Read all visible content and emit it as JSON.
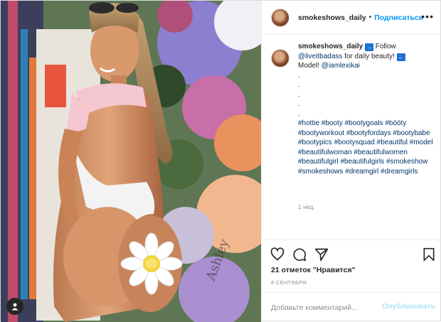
{
  "header": {
    "username": "smokeshows_daily",
    "separator": "•",
    "follow_label": "Подписаться",
    "more_icon": "more-horizontal-icon"
  },
  "caption": {
    "username": "smokeshows_daily",
    "follow_word": "Follow",
    "mention_1": "@liveitbadass",
    "text_1": "for daily beauty!",
    "text_2": "Model!",
    "mention_2": "@iamlexikai",
    "spacer": ".",
    "hashtags": "#hottie #booty #bootygoals #bööty #bootyworkout #bootyfordays #bootybabe #bootypics #bootysquad #beautiful #model #beautifulwoman #beautifulwomen #beautifulgirl #beautifulgirls #smokeshow #smokeshows #dreamgirl #dreamgirls",
    "time_ago": "1 нед."
  },
  "actions": {
    "like_icon": "heart-icon",
    "comment_icon": "comment-icon",
    "share_icon": "share-icon",
    "save_icon": "bookmark-icon"
  },
  "likes_text": "21 отметок \"Нравится\"",
  "date_text": "8 СЕНТЯБРЯ",
  "comment": {
    "placeholder": "Добавьте комментарий...",
    "publish_label": "Опубликовать"
  },
  "colors": {
    "link_blue": "#0095f6",
    "publish_disabled": "#b2dffc",
    "mention": "#00376b",
    "muted": "#8e8e8e"
  }
}
